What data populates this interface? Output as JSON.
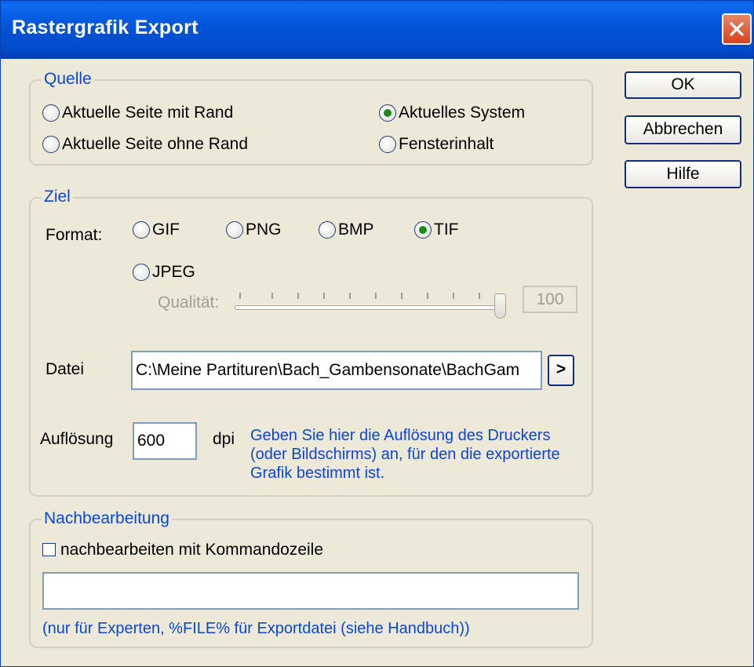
{
  "window": {
    "title": "Rastergrafik Export",
    "close_icon": "close-icon"
  },
  "buttons": {
    "ok": "OK",
    "cancel": "Abbrechen",
    "help": "Hilfe"
  },
  "quelle": {
    "label": "Quelle",
    "options": [
      {
        "label": "Aktuelle Seite mit Rand",
        "checked": false
      },
      {
        "label": "Aktuelles System",
        "checked": true
      },
      {
        "label": "Aktuelle Seite ohne Rand",
        "checked": false
      },
      {
        "label": "Fensterinhalt",
        "checked": false
      }
    ]
  },
  "ziel": {
    "label": "Ziel",
    "format_label": "Format:",
    "formats": [
      {
        "label": "GIF",
        "checked": false
      },
      {
        "label": "PNG",
        "checked": false
      },
      {
        "label": "BMP",
        "checked": false
      },
      {
        "label": "TIF",
        "checked": true
      },
      {
        "label": "JPEG",
        "checked": false
      }
    ],
    "quality_label": "Qualität:",
    "quality_value": "100",
    "quality_level": 1.0,
    "file_label": "Datei",
    "file_value": "C:\\Meine Partituren\\Bach_Gambensonate\\BachGam",
    "browse_label": ">",
    "resolution_label": "Auflösung",
    "resolution_value": "600",
    "resolution_unit": "dpi",
    "help_text": "Geben Sie hier die Auflösung des Druckers (oder Bildschirms) an, für den die exportierte Grafik bestimmt ist."
  },
  "nachbearbeitung": {
    "label": "Nachbearbeitung",
    "checkbox_label": "nachbearbeiten mit Kommandozeile",
    "checkbox_checked": false,
    "command_value": "",
    "note": "(nur für Experten, %FILE% für Exportdatei (siehe Handbuch))"
  }
}
